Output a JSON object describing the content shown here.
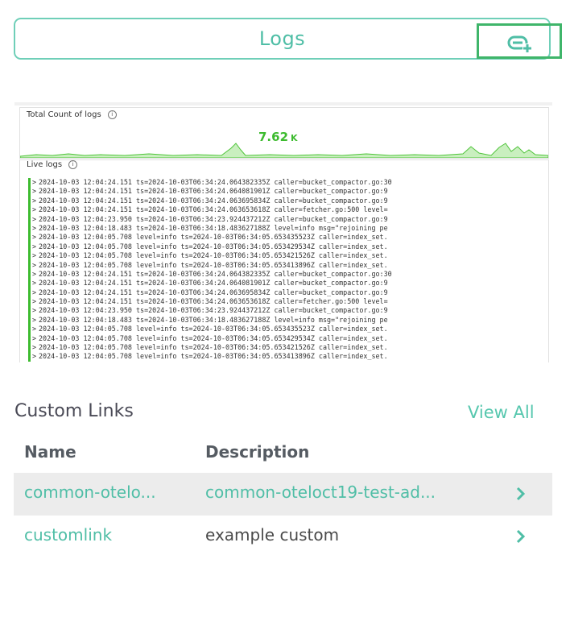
{
  "header": {
    "title": "Logs",
    "add_icon": "add-link-icon"
  },
  "preview": {
    "chart_title": "Total Count of logs",
    "count_value": "7.62",
    "count_unit": "K",
    "info_glyph": "i",
    "live_title": "Live logs",
    "chevron": ">",
    "log_lines": [
      "2024-10-03 12:04:24.151 ts=2024-10-03T06:34:24.064382335Z caller=bucket_compactor.go:30",
      "2024-10-03 12:04:24.151 ts=2024-10-03T06:34:24.064081901Z caller=bucket_compactor.go:9",
      "2024-10-03 12:04:24.151 ts=2024-10-03T06:34:24.063695834Z caller=bucket_compactor.go:9",
      "2024-10-03 12:04:24.151 ts=2024-10-03T06:34:24.063653618Z caller=fetcher.go:500 level=",
      "2024-10-03 12:04:23.950 ts=2024-10-03T06:34:23.924437212Z caller=bucket_compactor.go:9",
      "2024-10-03 12:04:18.483 ts=2024-10-03T06:34:18.483627188Z level=info msg=\"rejoining pe",
      "2024-10-03 12:04:05.708 level=info ts=2024-10-03T06:34:05.653435523Z caller=index_set.",
      "2024-10-03 12:04:05.708 level=info ts=2024-10-03T06:34:05.653429534Z caller=index_set.",
      "2024-10-03 12:04:05.708 level=info ts=2024-10-03T06:34:05.653421526Z caller=index_set.",
      "2024-10-03 12:04:05.708 level=info ts=2024-10-03T06:34:05.653413896Z caller=index_set.",
      "2024-10-03 12:04:24.151 ts=2024-10-03T06:34:24.064382335Z caller=bucket_compactor.go:30",
      "2024-10-03 12:04:24.151 ts=2024-10-03T06:34:24.064081901Z caller=bucket_compactor.go:9",
      "2024-10-03 12:04:24.151 ts=2024-10-03T06:34:24.063695834Z caller=bucket_compactor.go:9",
      "2024-10-03 12:04:24.151 ts=2024-10-03T06:34:24.063653618Z caller=fetcher.go:500 level=",
      "2024-10-03 12:04:23.950 ts=2024-10-03T06:34:23.924437212Z caller=bucket_compactor.go:9",
      "2024-10-03 12:04:18.483 ts=2024-10-03T06:34:18.483627188Z level=info msg=\"rejoining pe",
      "2024-10-03 12:04:05.708 level=info ts=2024-10-03T06:34:05.653435523Z caller=index_set.",
      "2024-10-03 12:04:05.708 level=info ts=2024-10-03T06:34:05.653429534Z caller=index_set.",
      "2024-10-03 12:04:05.708 level=info ts=2024-10-03T06:34:05.653421526Z caller=index_set.",
      "2024-10-03 12:04:05.708 level=info ts=2024-10-03T06:34:05.653413896Z caller=index_set."
    ],
    "accent_color": "#3dbb2f"
  },
  "custom_links": {
    "heading": "Custom Links",
    "view_all": "View All",
    "columns": {
      "name": "Name",
      "description": "Description"
    },
    "rows": [
      {
        "name": "common-otelo...",
        "description": "common-oteloct19-test-ad...",
        "chevron_icon": "chevron-right-icon"
      },
      {
        "name": "customlink",
        "description": "example custom",
        "chevron_icon": "chevron-right-icon"
      }
    ]
  },
  "colors": {
    "brand_teal": "#4fbea6",
    "highlight_green": "#3fb56a",
    "row_highlight": "#ececec"
  }
}
